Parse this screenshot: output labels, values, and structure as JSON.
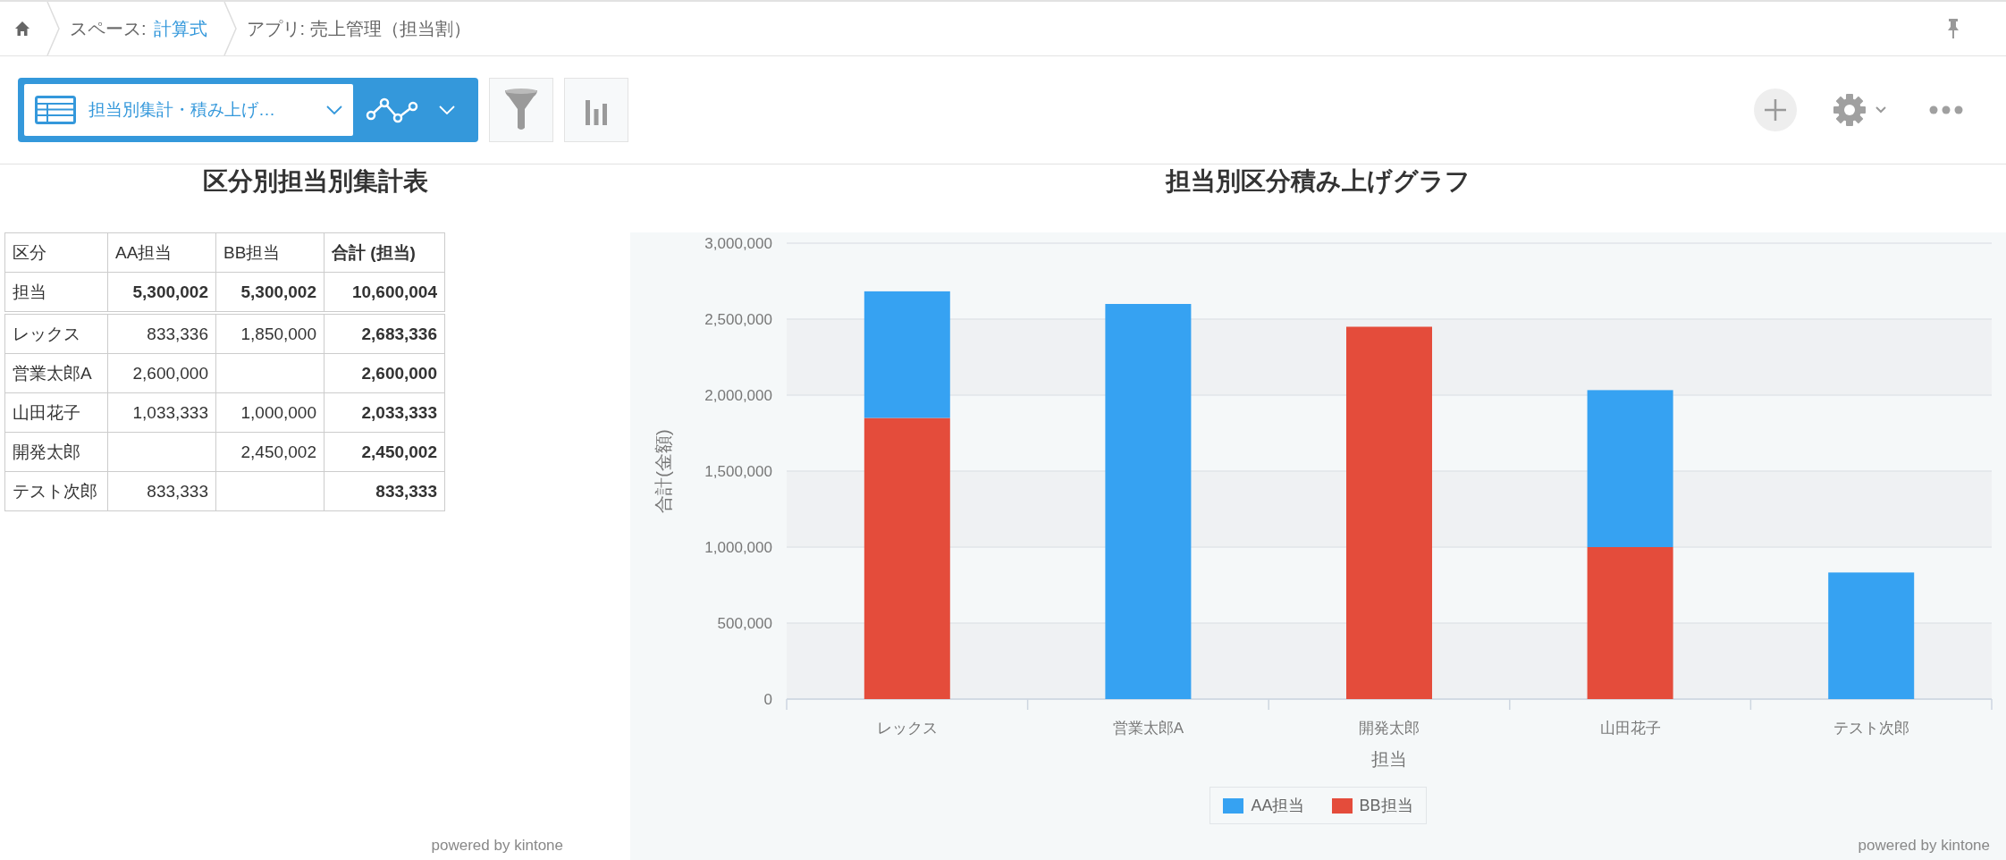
{
  "breadcrumb": [
    {
      "prefix": "スペース:",
      "link": "計算式"
    },
    {
      "prefix": "アプリ: 売上管理（担当割）"
    }
  ],
  "toolbar": {
    "view_select": "担当別集計・積み上げ…"
  },
  "table_panel": {
    "title": "区分別担当別集計表",
    "columns": [
      {
        "label": "区分",
        "kind": "name"
      },
      {
        "label": "AA担当",
        "kind": "value"
      },
      {
        "label": "BB担当",
        "kind": "value"
      },
      {
        "label": "合計 (担当)",
        "kind": "total"
      }
    ],
    "total_row": [
      "担当",
      "5,300,002",
      "5,300,002",
      "10,600,004"
    ],
    "rows": [
      [
        "レックス",
        "833,336",
        "1,850,000",
        "2,683,336"
      ],
      [
        "営業太郎A",
        "2,600,000",
        null,
        "2,600,000"
      ],
      [
        "山田花子",
        "1,033,333",
        "1,000,000",
        "2,033,333"
      ],
      [
        "開発太郎",
        null,
        "2,450,002",
        "2,450,002"
      ],
      [
        "テスト次郎",
        "833,333",
        null,
        "833,333"
      ]
    ],
    "footer": "powered by kintone"
  },
  "chart_panel": {
    "chart_data": {
      "type": "bar",
      "title": "担当別区分積み上げグラフ",
      "stacked": true,
      "xlabel": "担当",
      "ylabel": "合計(金額)",
      "categories": [
        "レックス",
        "営業太郎A",
        "開発太郎",
        "山田花子",
        "テスト次郎"
      ],
      "series": [
        {
          "name": "AA担当",
          "color": "#36a2f2",
          "values": [
            833000,
            2600000,
            null,
            1033000,
            833000
          ]
        },
        {
          "name": "BB担当",
          "color": "#e44c3b",
          "values": [
            1850000,
            null,
            2450000,
            1000000,
            null
          ]
        }
      ],
      "grid": true,
      "ylim": [
        0,
        3000000
      ],
      "yticks": [
        {
          "value": 0,
          "label": "0"
        },
        {
          "value": 500000,
          "label": "500,000"
        },
        {
          "value": 1000000,
          "label": "1,000,000"
        },
        {
          "value": 1500000,
          "label": "1,500,000"
        },
        {
          "value": 2000000,
          "label": "2,000,000"
        },
        {
          "value": 2500000,
          "label": "2,500,000"
        },
        {
          "value": 3000000,
          "label": "3,000,000"
        }
      ]
    },
    "footer": "powered by kintone"
  }
}
